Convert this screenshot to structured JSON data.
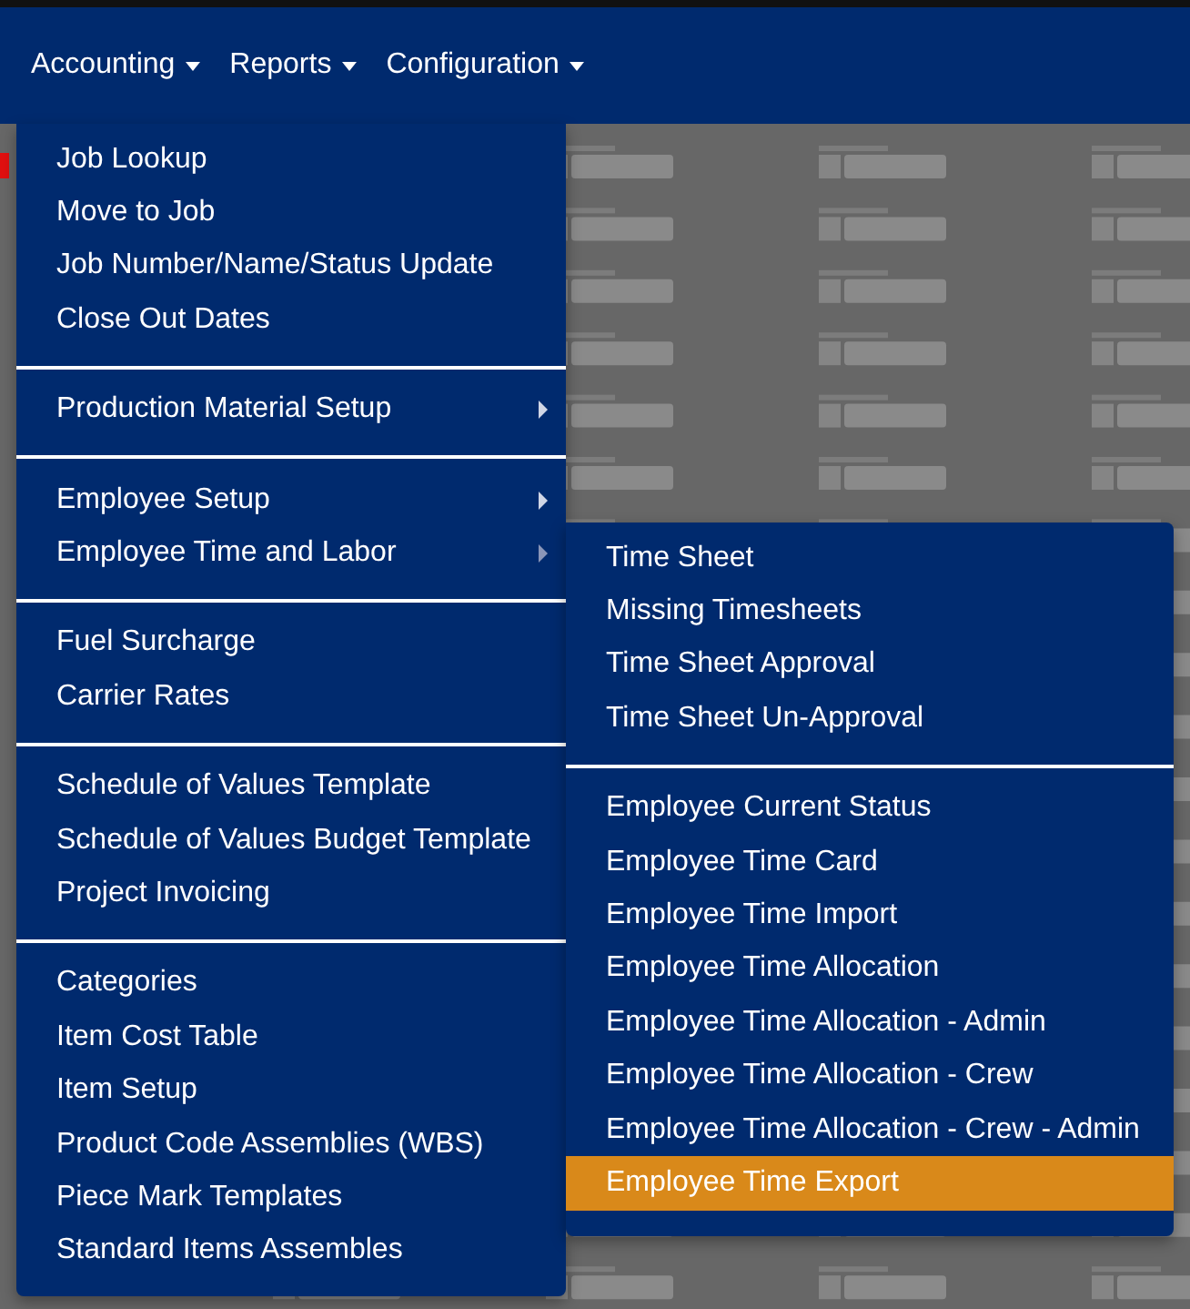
{
  "navbar": [
    {
      "label": "Accounting"
    },
    {
      "label": "Reports"
    },
    {
      "label": "Configuration"
    }
  ],
  "menu": [
    {
      "items": [
        {
          "label": "Job Lookup",
          "submenu": false
        },
        {
          "label": "Move to Job",
          "submenu": false
        },
        {
          "label": "Job Number/Name/Status Update",
          "submenu": false
        },
        {
          "label": "Close Out Dates",
          "submenu": false
        }
      ]
    },
    {
      "items": [
        {
          "label": "Production Material Setup",
          "submenu": true,
          "expanded": false
        }
      ]
    },
    {
      "items": [
        {
          "label": "Employee Setup",
          "submenu": true,
          "expanded": false
        },
        {
          "label": "Employee Time and Labor",
          "submenu": true,
          "expanded": true
        }
      ]
    },
    {
      "items": [
        {
          "label": "Fuel Surcharge",
          "submenu": false
        },
        {
          "label": "Carrier Rates",
          "submenu": false
        }
      ]
    },
    {
      "items": [
        {
          "label": "Schedule of Values Template",
          "submenu": false
        },
        {
          "label": "Schedule of Values Budget Template",
          "submenu": false
        },
        {
          "label": "Project Invoicing",
          "submenu": false
        }
      ]
    },
    {
      "items": [
        {
          "label": "Categories",
          "submenu": false
        },
        {
          "label": "Item Cost Table",
          "submenu": false
        },
        {
          "label": "Item Setup",
          "submenu": false
        },
        {
          "label": "Product Code Assemblies (WBS)",
          "submenu": false
        },
        {
          "label": "Piece Mark Templates",
          "submenu": false
        },
        {
          "label": "Standard Items Assembles",
          "submenu": false
        }
      ]
    }
  ],
  "submenu": [
    {
      "items": [
        {
          "label": "Time Sheet",
          "selected": false
        },
        {
          "label": "Missing Timesheets",
          "selected": false
        },
        {
          "label": "Time Sheet Approval",
          "selected": false
        },
        {
          "label": "Time Sheet Un-Approval",
          "selected": false
        }
      ]
    },
    {
      "items": [
        {
          "label": "Employee Current Status",
          "selected": false
        },
        {
          "label": "Employee Time Card",
          "selected": false
        },
        {
          "label": "Employee Time Import",
          "selected": false
        },
        {
          "label": "Employee Time Allocation",
          "selected": false
        },
        {
          "label": "Employee Time Allocation - Admin",
          "selected": false
        },
        {
          "label": "Employee Time Allocation - Crew",
          "selected": false
        },
        {
          "label": "Employee Time Allocation - Crew - Admin",
          "selected": false
        },
        {
          "label": "Employee Time Export",
          "selected": true
        }
      ]
    }
  ]
}
